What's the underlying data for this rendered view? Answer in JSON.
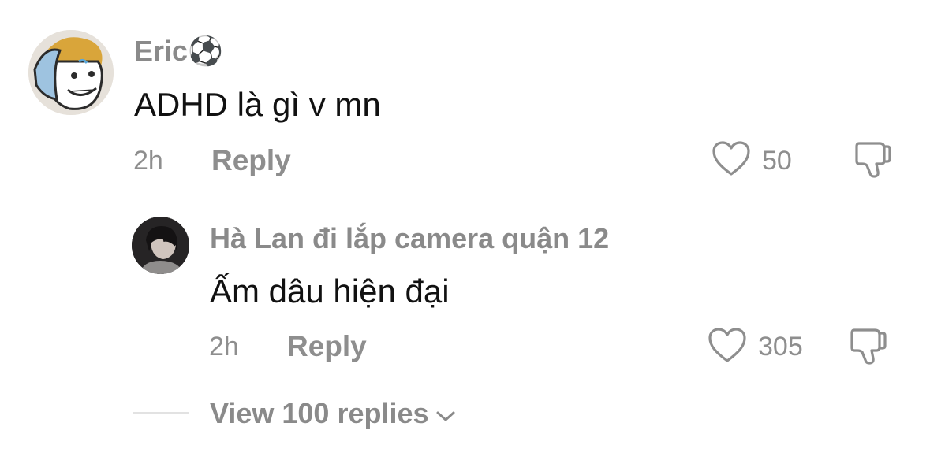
{
  "comments": [
    {
      "username": "Eric",
      "username_emoji": "⚽",
      "text": "ADHD là gì v mn",
      "time": "2h",
      "reply_label": "Reply",
      "like_count": "50",
      "avatar_icon": "cartoon-avatar"
    },
    {
      "username": "Hà Lan đi lắp camera quận 12",
      "text": "Ấm dâu hiện đại",
      "time": "2h",
      "reply_label": "Reply",
      "like_count": "305",
      "avatar_icon": "photo-avatar"
    }
  ],
  "view_replies": {
    "label": "View 100 replies",
    "icon": "chevron-down-icon"
  },
  "colors": {
    "text_primary": "#111111",
    "text_secondary": "#8a8a8a",
    "background": "#ffffff"
  }
}
